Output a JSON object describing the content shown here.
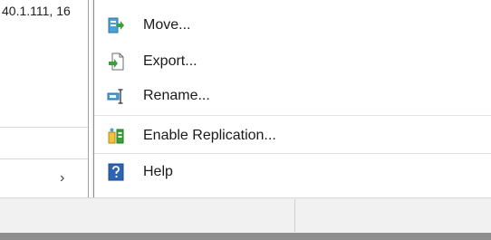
{
  "left_pane": {
    "truncated_text": "40.1.111, 16",
    "scroll_chevron": "›"
  },
  "menu": {
    "items": [
      {
        "label": "Move...",
        "icon": "move-icon"
      },
      {
        "label": "Export...",
        "icon": "export-icon"
      },
      {
        "label": "Rename...",
        "icon": "rename-icon"
      },
      {
        "label": "Enable Replication...",
        "icon": "replication-icon"
      },
      {
        "label": "Help",
        "icon": "help-icon"
      }
    ]
  },
  "colors": {
    "menu_bg": "#ffffff",
    "status_bar_bg": "#f1f1f1",
    "icon_green": "#3aa13a",
    "icon_blue": "#2d64b3",
    "icon_yellow": "#f0c43a"
  }
}
